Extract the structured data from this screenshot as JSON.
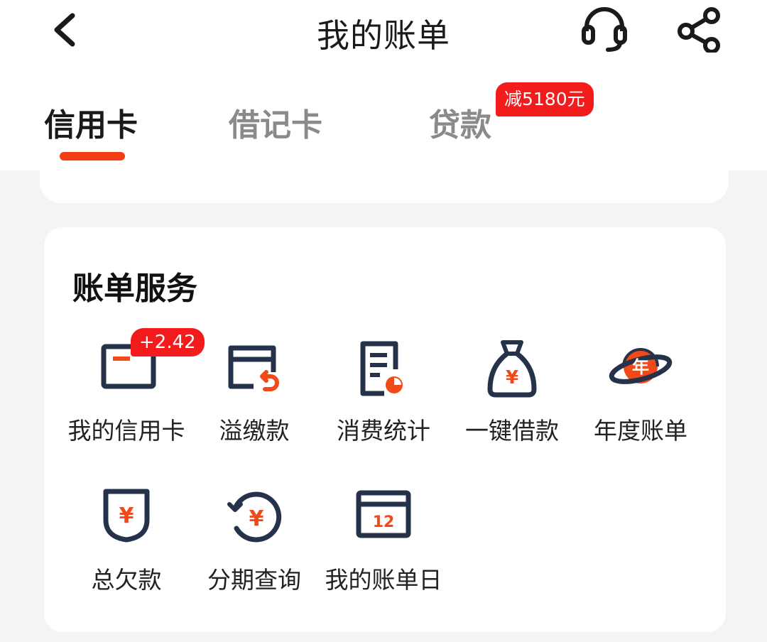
{
  "header": {
    "title": "我的账单",
    "back_icon": "chevron-left-icon",
    "support_icon": "headset-icon",
    "share_icon": "share-icon"
  },
  "tabs": [
    {
      "label": "信用卡",
      "active": true
    },
    {
      "label": "借记卡",
      "active": false
    },
    {
      "label": "贷款",
      "active": false,
      "badge": "减5180元"
    }
  ],
  "services": {
    "title": "账单服务",
    "items": [
      {
        "label": "我的信用卡",
        "icon": "credit-card-icon",
        "badge": "+2.42"
      },
      {
        "label": "溢缴款",
        "icon": "card-refund-icon"
      },
      {
        "label": "消费统计",
        "icon": "report-chart-icon"
      },
      {
        "label": "一键借款",
        "icon": "money-bag-icon"
      },
      {
        "label": "年度账单",
        "icon": "planet-year-icon",
        "icon_text": "年"
      },
      {
        "label": "总欠款",
        "icon": "yuan-shield-icon"
      },
      {
        "label": "分期查询",
        "icon": "yuan-cycle-icon"
      },
      {
        "label": "我的账单日",
        "icon": "calendar-icon",
        "icon_text": "12"
      }
    ]
  },
  "colors": {
    "accent": "#f23d14",
    "badge": "#f21c1c",
    "icon_dark": "#26324a",
    "icon_orange": "#f04a1a"
  }
}
